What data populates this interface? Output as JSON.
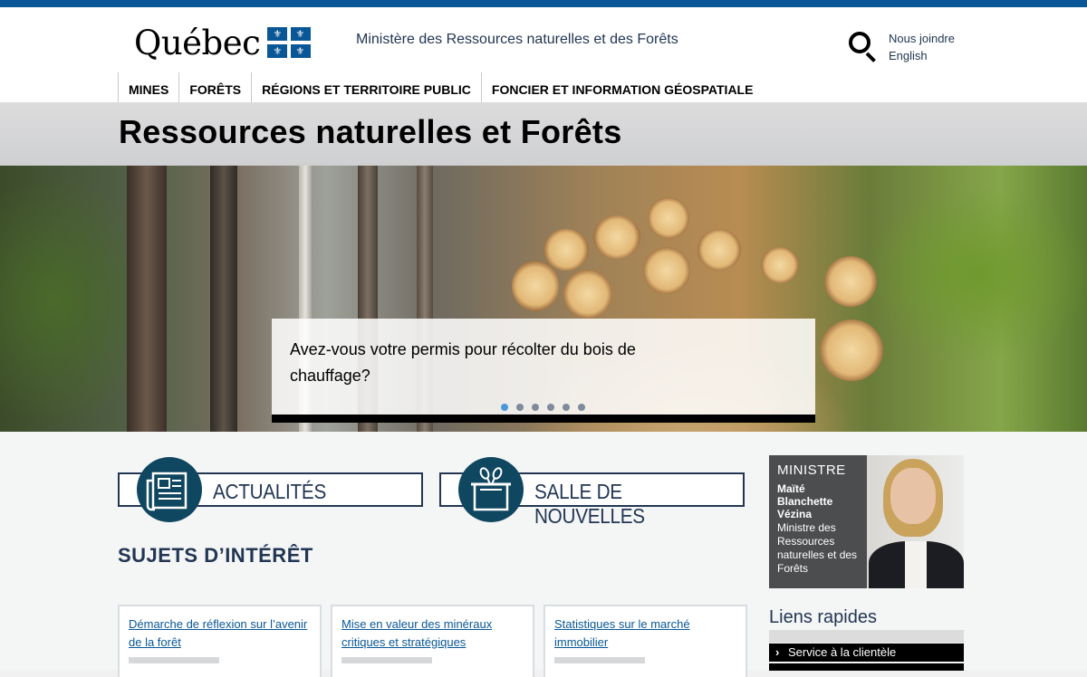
{
  "header": {
    "logo_text": "Québec",
    "ministry_name": "Ministère des Ressources naturelles et des Forêts",
    "search_icon": "search-icon",
    "links": [
      "Nous joindre",
      "English"
    ]
  },
  "nav": {
    "items": [
      "MINES",
      "FORÊTS",
      "RÉGIONS ET TERRITOIRE PUBLIC",
      "FONCIER ET INFORMATION GÉOSPATIALE"
    ]
  },
  "page": {
    "title": "Ressources naturelles et Forêts"
  },
  "carousel": {
    "slide_text": "Avez-vous votre permis pour récolter du bois de chauffage?",
    "slide_count": 6,
    "active_index": 0
  },
  "promos": {
    "news": {
      "label": "ACTUALITÉS",
      "icon": "newspaper-icon"
    },
    "newsroom": {
      "label": "SALLE DE NOUVELLES",
      "icon": "podium-microphones-icon"
    }
  },
  "topics": {
    "title": "SUJETS D’INTÉRÊT",
    "items": [
      "Démarche de réflexion sur l’avenir de la forêt",
      "Mise en valeur des minéraux critiques et stratégiques",
      "Statistiques sur le marché immobilier"
    ]
  },
  "minister": {
    "heading": "MINISTRE",
    "name": "Maïté Blanchette Vézina",
    "role": "Ministre des Ressources naturelles et des Forêts"
  },
  "quick_links": {
    "title": "Liens rapides",
    "items": [
      "Service à la clientèle"
    ]
  },
  "colors": {
    "brand_blue": "#095797",
    "dark_navy": "#223654",
    "icon_teal": "#0f4660",
    "carousel_active": "#4a98d9"
  }
}
